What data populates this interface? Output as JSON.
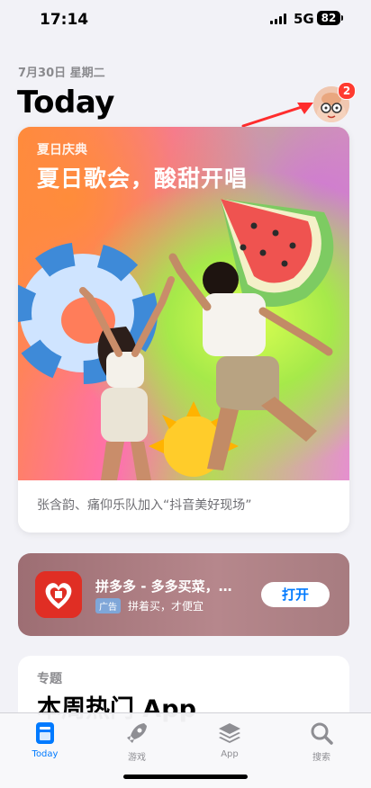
{
  "status": {
    "time": "17:14",
    "network": "5G",
    "battery": "82"
  },
  "header": {
    "date": "7月30日 星期二",
    "title": "Today",
    "badge": "2"
  },
  "story": {
    "eyebrow": "夏日庆典",
    "headline": "夏日歌会，酸甜开唱",
    "subtitle": "张含韵、痛仰乐队加入“抖音美好现场”"
  },
  "ad": {
    "app_name": "拼多多 - 多多买菜，…",
    "ad_tag": "广告",
    "tagline": "拼着买，才便宜",
    "open_label": "打开"
  },
  "collection": {
    "eyebrow": "专题",
    "title": "本周热门 App"
  },
  "tabs": [
    {
      "label": "Today",
      "icon": "today-icon",
      "active": true
    },
    {
      "label": "游戏",
      "icon": "rocket-icon"
    },
    {
      "label": "App",
      "icon": "layers-icon"
    },
    {
      "label": "搜索",
      "icon": "search-icon"
    }
  ],
  "colors": {
    "accent": "#007aff",
    "badge": "#ff3b30",
    "ad_icon": "#e02e24"
  }
}
